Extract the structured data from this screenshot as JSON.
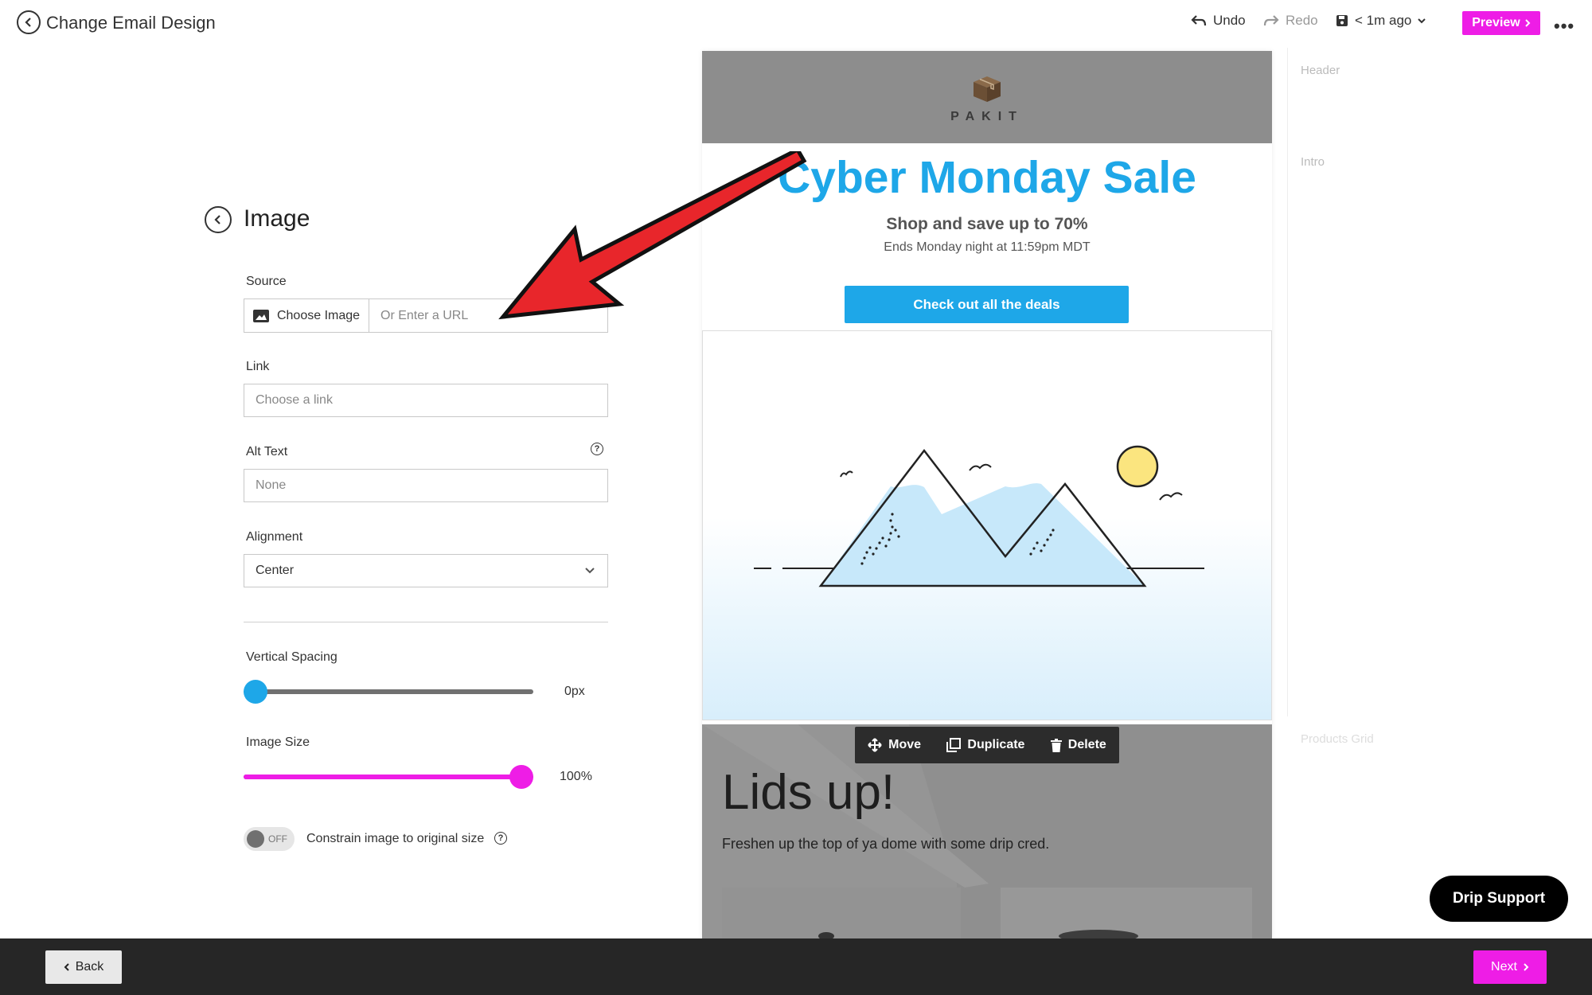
{
  "topbar": {
    "title": "Change Email Design",
    "undo_label": "Undo",
    "redo_label": "Redo",
    "save_status": "< 1m ago",
    "preview_label": "Preview",
    "more_glyph": "•••"
  },
  "panel": {
    "title": "Image",
    "source_label": "Source",
    "choose_image_label": "Choose Image",
    "url_placeholder": "Or Enter a URL",
    "link_label": "Link",
    "link_placeholder": "Choose a link",
    "alt_label": "Alt Text",
    "alt_placeholder": "None",
    "alignment_label": "Alignment",
    "alignment_value": "Center",
    "vspacing_label": "Vertical Spacing",
    "vspacing_value": "0px",
    "vspacing_fraction": 0,
    "imagesize_label": "Image Size",
    "imagesize_value": "100%",
    "imagesize_fraction": 1,
    "toggle_state": "OFF",
    "constrain_label": "Constrain image to original size"
  },
  "email": {
    "logo_text": "PAKIT",
    "hero_title": "Cyber Monday Sale",
    "hero_subtitle": "Shop and save up to 70%",
    "hero_small": "Ends Monday night at 11:59pm MDT",
    "cta_label": "Check out all the deals",
    "lids_title": "Lids up!",
    "lids_subtitle": "Freshen up the top of ya dome with some drip cred."
  },
  "block_toolbar": {
    "move_label": "Move",
    "duplicate_label": "Duplicate",
    "delete_label": "Delete"
  },
  "outline": {
    "header_label": "Header",
    "intro_label": "Intro",
    "products_label": "Products Grid"
  },
  "support_label": "Drip Support",
  "bottombar": {
    "back_label": "Back",
    "next_label": "Next"
  },
  "colors": {
    "accent_magenta": "#ee1de6",
    "accent_blue": "#1ea7e8",
    "annotation_arrow": "#e8262b"
  }
}
